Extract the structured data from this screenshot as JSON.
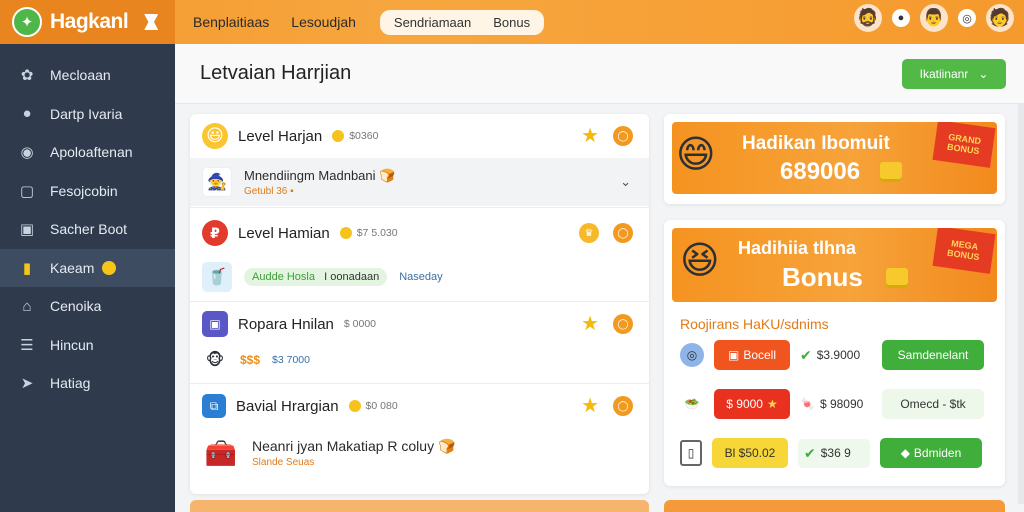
{
  "app": {
    "name": "Hagkanl"
  },
  "topnav": {
    "links": [
      "Benplaitiaas",
      "Lesoudjah"
    ],
    "pill_links": [
      "Sendriamaan",
      "Bonus"
    ]
  },
  "sidebar": {
    "items": [
      {
        "label": "Mecloaan",
        "icon": "gamepad-icon"
      },
      {
        "label": "Dartp Ivaria",
        "icon": "user-icon"
      },
      {
        "label": "Apoloaftenan",
        "icon": "user-circle-icon"
      },
      {
        "label": "Fesojcobin",
        "icon": "document-icon"
      },
      {
        "label": "Sacher Boot",
        "icon": "chart-icon"
      },
      {
        "label": "Kaeam",
        "icon": "bar-chart-icon",
        "active": true
      },
      {
        "label": "Cenoika",
        "icon": "home-icon"
      },
      {
        "label": "Hincun",
        "icon": "list-icon"
      },
      {
        "label": "Hatiag",
        "icon": "bird-icon"
      }
    ]
  },
  "page": {
    "title": "Letvaian Harrjian",
    "header_button": "Ikatiinanr"
  },
  "levels": [
    {
      "title": "Level Harjan",
      "meta": "$0360",
      "sub_main": "Mnendiingm Madnbani",
      "sub_note": "Getubl 36"
    },
    {
      "title": "Level Hamian",
      "meta": "$7 5.030",
      "tag_green": "Audde Hosla",
      "tag_mid": "I oonadaan",
      "tag_blue": "Naseday"
    },
    {
      "title": "Ropara Hnilan",
      "meta": "$ 0000",
      "sub_gold": "$$$",
      "sub_gold_meta": "$3 7000"
    },
    {
      "title": "Bavial Hrargian",
      "meta": "$0 080",
      "sub_main": "Neanri jyan Makatiap R coluy",
      "sub_note": "Slande Seuas"
    }
  ],
  "promo_a": {
    "title": "Hadikan Ibomuit",
    "number": "689006",
    "ribbon": "GRAND BONUS"
  },
  "promo_b": {
    "title": "Hadihiia tlhna",
    "subtitle": "Bonus",
    "ribbon": "MEGA BONUS"
  },
  "rewards": {
    "title": "Roojirans HaKU/sdnims",
    "rows": [
      {
        "chip": "Bocell",
        "chip_style": "orange",
        "value": "$3.9000",
        "action": "Samdenelant",
        "action_style": "green"
      },
      {
        "chip": "$ 9000",
        "chip_style": "red",
        "value": "$ 98090",
        "action": "Omecd - $tk",
        "action_style": "light"
      },
      {
        "chip": "Bl $50.02",
        "chip_style": "yellow",
        "value": "$36 9",
        "action": "Bdmiden",
        "action_style": "green"
      }
    ]
  },
  "colors": {
    "topbar": "#f39a2e",
    "sidebar": "#2f3b4c",
    "accent_green": "#52b947",
    "accent_orange": "#f29a1f"
  }
}
